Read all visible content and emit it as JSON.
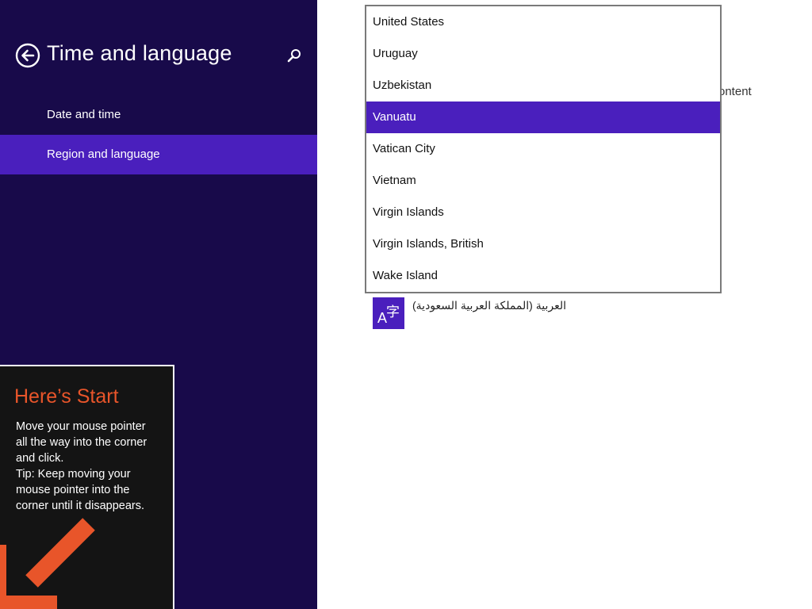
{
  "sidebar": {
    "title": "Time and language",
    "nav_items": [
      {
        "label": "Date and time"
      },
      {
        "label": "Region and language",
        "selected": true
      }
    ],
    "background": "#180a4a",
    "accent": "#4a1fbd"
  },
  "dropdown": {
    "options": [
      "United States",
      "Uruguay",
      "Uzbekistan",
      "Vanuatu",
      "Vatican City",
      "Vietnam",
      "Virgin Islands",
      "Virgin Islands, British",
      "Wake Island"
    ],
    "selected": "Vanuatu"
  },
  "content": {
    "partial_text": "ontent",
    "language_tile_glyphs": {
      "latin": "A",
      "cjk": "字"
    },
    "language_name": "العربية (المملكة العربية السعودية)"
  },
  "start_tip": {
    "title": "Here’s Start",
    "lines": [
      "Move your mouse pointer",
      "all the way into the corner",
      "and click.",
      "Tip: Keep moving your",
      "mouse pointer into the",
      "corner until it disappears."
    ],
    "accent": "#e8552a"
  },
  "icons": {
    "back": "back-arrow-circle-icon",
    "search": "search-icon",
    "tip_arrow": "arrow-down-left-icon"
  }
}
